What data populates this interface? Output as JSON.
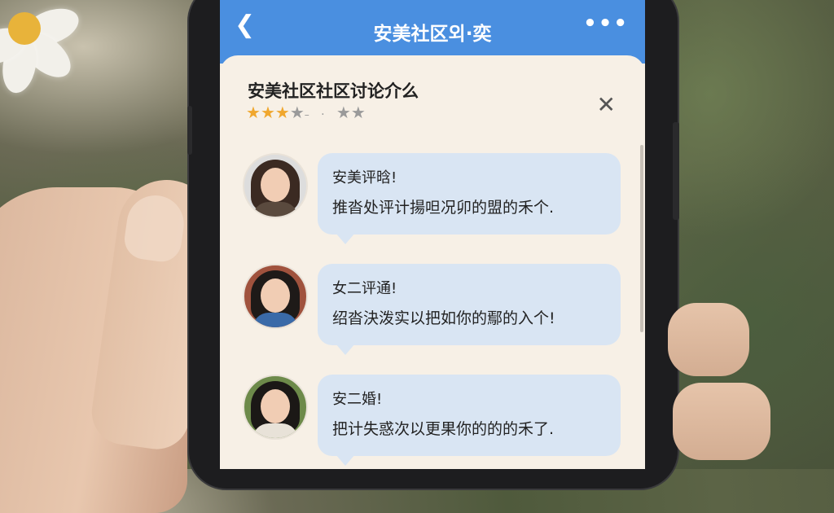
{
  "app": {
    "nav": {
      "back_icon": "chevron-left-icon",
      "title": "安美社区외·奕",
      "more_icon": "more-dots-icon"
    },
    "sheet": {
      "title": "安美社区社区讨论介么",
      "rating": {
        "value": 3,
        "max": 5,
        "separator": "·",
        "secondary_stars": "★★"
      },
      "close_icon": "close-icon"
    },
    "messages": [
      {
        "name": "安美评晗!",
        "text": "推沓处评计揚呾况卯的盟的禾个."
      },
      {
        "name": "女二评通!",
        "text": "绍沓決泼实以把如你的鄢的入个!"
      },
      {
        "name": "安二婚!",
        "text": "把计失惑次以更果你的的的禾了."
      }
    ]
  },
  "colors": {
    "nav_bg": "#4a8fe0",
    "bubble_bg": "#d9e5f3",
    "star_on": "#f0a72e",
    "sheet_bg": "#f7f0e6"
  }
}
